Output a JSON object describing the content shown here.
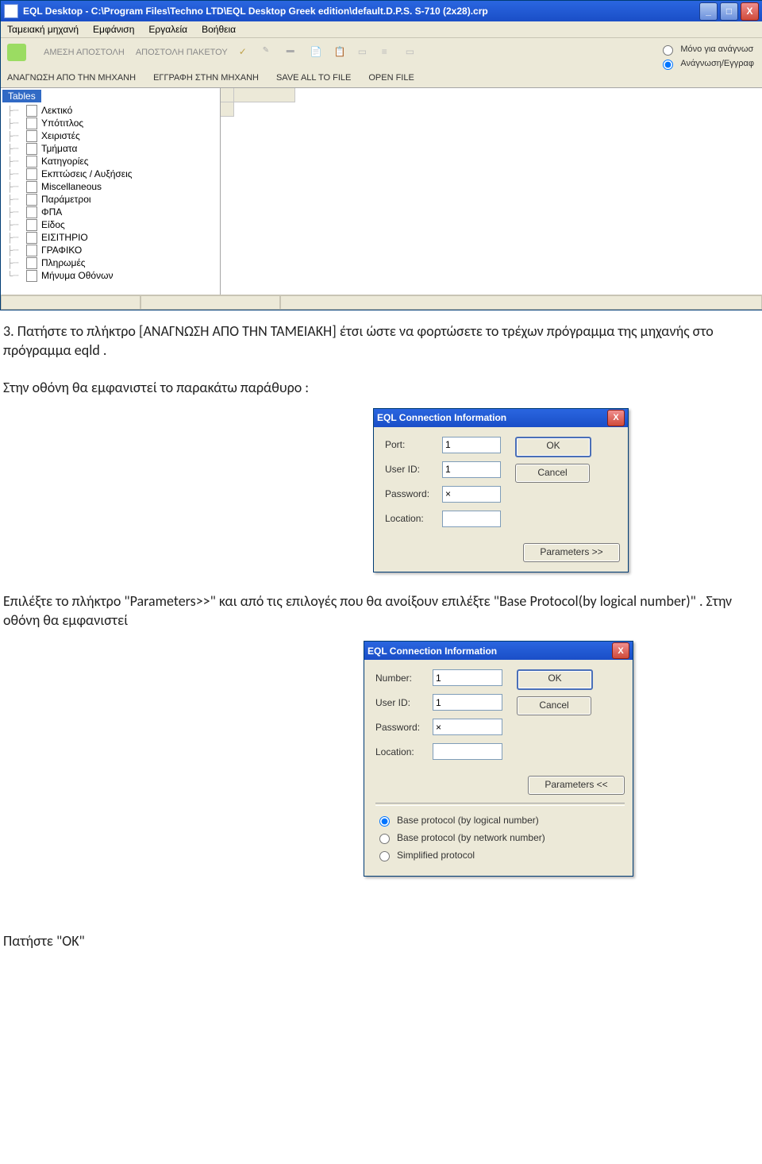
{
  "main_window": {
    "title": "EQL Desktop - C:\\Program Files\\Techno LTD\\EQL Desktop Greek edition\\default.D.P.S. S-710 (2x28).crp",
    "menu": [
      "Ταμειακή μηχανή",
      "Εμφάνιση",
      "Εργαλεία",
      "Βοήθεια"
    ],
    "toolbar_top": {
      "amesi": "ΑΜΕΣΗ ΑΠΟΣΤΟΛΗ",
      "paketou": "ΑΠΟΣΤΟΛΗ ΠΑΚΕΤΟΥ"
    },
    "toolbar_bottom": {
      "read": "ΑΝΑΓΝΩΣΗ ΑΠΟ ΤΗΝ ΜΗΧΑΝΗ",
      "write": "ΕΓΓΡΑΦΗ ΣΤΗΝ ΜΗΧΑΝΗ",
      "save": "SAVE ALL TO FILE",
      "open": "OPEN FILE"
    },
    "radio": {
      "read_only": "Μόνο για ανάγνωσ",
      "read_write": "Ανάγνωση/Εγγραφ"
    },
    "tree_root": "Tables",
    "tree_items": [
      "Λεκτικό",
      "Υπότιτλος",
      "Χειριστές",
      "Τμήματα",
      "Κατηγορίες",
      "Εκπτώσεις / Αυξήσεις",
      "Miscellaneous",
      "Παράμετροι",
      "ΦΠΑ",
      "Είδος",
      "ΕΙΣΙΤΗΡΙΟ",
      "ΓΡΑΦΙΚΟ",
      "Πληρωμές",
      "Μήνυμα Οθόνων"
    ]
  },
  "para1": "3. Πατήστε το πλήκτρο [ΑΝΑΓΝΩΣΗ ΑΠΟ ΤΗΝ ΤΑΜΕΙΑΚΗ] έτσι ώστε να φορτώσετε το τρέχων πρόγραμμα της μηχανής στο πρόγραμμα eqld .",
  "para2": "Στην οθόνη θα εμφανιστεί το παρακάτω παράθυρο :",
  "para3": "Επιλέξτε το πλήκτρο \"Parameters>>\" και από τις επιλογές που θα ανοίξουν επιλέξτε \"Base Protocol(by logical number)\" . Στην οθόνη θα εμφανιστεί",
  "para4": "Πατήστε \"OK\"",
  "dialog1": {
    "title": "EQL Connection Information",
    "port_label": "Port:",
    "port_value": "1",
    "user_label": "User ID:",
    "user_value": "1",
    "pass_label": "Password:",
    "pass_value": "×",
    "loc_label": "Location:",
    "loc_value": "",
    "ok": "OK",
    "cancel": "Cancel",
    "params": "Parameters >>"
  },
  "dialog2": {
    "title": "EQL Connection Information",
    "num_label": "Number:",
    "num_value": "1",
    "user_label": "User ID:",
    "user_value": "1",
    "pass_label": "Password:",
    "pass_value": "×",
    "loc_label": "Location:",
    "loc_value": "",
    "ok": "OK",
    "cancel": "Cancel",
    "params": "Parameters <<",
    "opt1": "Base protocol (by logical number)",
    "opt2": "Base protocol (by network number)",
    "opt3": "Simplified protocol"
  }
}
